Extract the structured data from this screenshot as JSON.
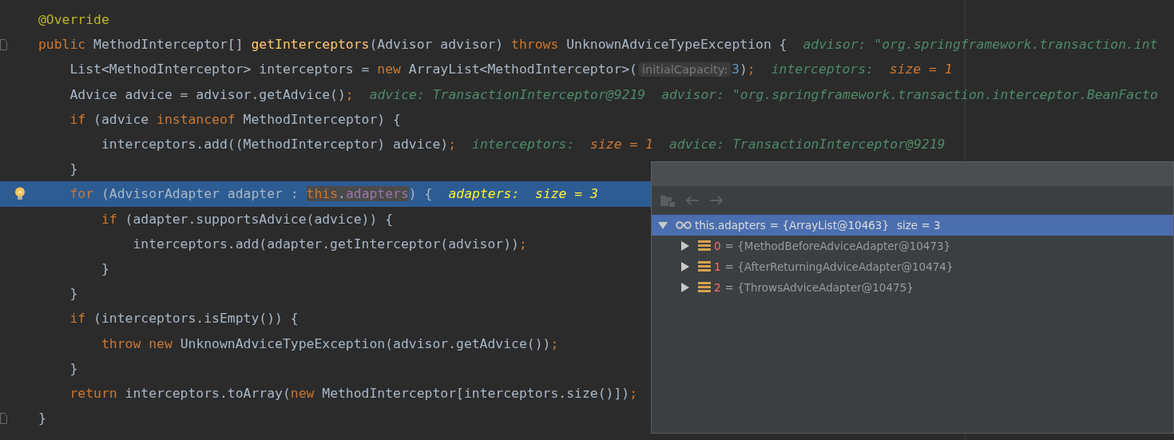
{
  "code": {
    "lines": [
      {
        "selected": false,
        "segments": [
          {
            "kind": "code",
            "tokens": [
              {
                "text": "@Override",
                "kind": "annotation"
              }
            ]
          }
        ]
      },
      {
        "selected": false,
        "gutter": {
          "kind": "fold"
        },
        "segments": [
          {
            "kind": "code",
            "tokens": [
              {
                "text": "public ",
                "kind": "keyword"
              },
              {
                "text": "MethodInterceptor[] ",
                "kind": "plain"
              },
              {
                "text": "getInterceptors",
                "kind": "method"
              },
              {
                "text": "(Advisor advisor) ",
                "kind": "plain"
              },
              {
                "text": "throws ",
                "kind": "keyword"
              },
              {
                "text": "UnknownAdviceTypeException {",
                "kind": "plain"
              }
            ]
          },
          {
            "kind": "value_hint",
            "tokens": [
              {
                "text": "advisor: \"org.springframework.transaction.int",
                "kind": "name"
              }
            ]
          }
        ],
        "children": [
          {
            "selected": false,
            "segments": [
              {
                "kind": "code",
                "tokens": [
                  {
                    "text": "List<MethodInterceptor> interceptors = ",
                    "kind": "plain"
                  },
                  {
                    "text": "new ",
                    "kind": "keyword"
                  },
                  {
                    "text": "ArrayList<MethodInterceptor>(",
                    "kind": "plain"
                  }
                ]
              },
              {
                "kind": "param_hint",
                "text": "initialCapacity:"
              },
              {
                "kind": "code",
                "tokens": [
                  {
                    "text": "3",
                    "kind": "number"
                  },
                  {
                    "text": ")",
                    "kind": "plain"
                  },
                  {
                    "text": ";",
                    "kind": "punct"
                  }
                ]
              },
              {
                "kind": "value_hint",
                "tokens": [
                  {
                    "text": "interceptors:  ",
                    "kind": "name"
                  },
                  {
                    "text": "size = 1",
                    "kind": "size"
                  }
                ]
              }
            ]
          },
          {
            "selected": false,
            "segments": [
              {
                "kind": "code",
                "tokens": [
                  {
                    "text": "Advice advice = advisor.getAdvice()",
                    "kind": "plain"
                  },
                  {
                    "text": ";",
                    "kind": "punct"
                  }
                ]
              },
              {
                "kind": "value_hint",
                "tokens": [
                  {
                    "text": "advice: TransactionInterceptor@9219",
                    "kind": "name"
                  }
                ]
              },
              {
                "kind": "value_hint",
                "tokens": [
                  {
                    "text": "advisor: \"org.springframework.transaction.interceptor.BeanFacto",
                    "kind": "name"
                  }
                ]
              }
            ]
          },
          {
            "selected": false,
            "segments": [
              {
                "kind": "code",
                "tokens": [
                  {
                    "text": "if ",
                    "kind": "keyword"
                  },
                  {
                    "text": "(advice ",
                    "kind": "plain"
                  },
                  {
                    "text": "instanceof ",
                    "kind": "keyword"
                  },
                  {
                    "text": "MethodInterceptor) {",
                    "kind": "plain"
                  }
                ]
              }
            ],
            "children": [
              {
                "selected": false,
                "segments": [
                  {
                    "kind": "code",
                    "tokens": [
                      {
                        "text": "interceptors.add((MethodInterceptor) advice)",
                        "kind": "plain"
                      },
                      {
                        "text": ";",
                        "kind": "punct"
                      }
                    ]
                  },
                  {
                    "kind": "value_hint",
                    "tokens": [
                      {
                        "text": "interceptors:  ",
                        "kind": "name"
                      },
                      {
                        "text": "size = 1",
                        "kind": "size"
                      }
                    ]
                  },
                  {
                    "kind": "value_hint",
                    "tokens": [
                      {
                        "text": "advice: TransactionInterceptor@9219",
                        "kind": "name"
                      }
                    ]
                  }
                ]
              }
            ]
          },
          {
            "selected": false,
            "segments": [
              {
                "kind": "code",
                "tokens": [
                  {
                    "text": "}",
                    "kind": "plain"
                  }
                ]
              }
            ]
          },
          {
            "selected": true,
            "gutter": {
              "kind": "bulb"
            },
            "segments": [
              {
                "kind": "code",
                "tokens": [
                  {
                    "text": "for ",
                    "kind": "keyword"
                  },
                  {
                    "text": "(AdvisorAdapter adapter : ",
                    "kind": "plain"
                  }
                ]
              },
              {
                "kind": "usage",
                "tokens": [
                  {
                    "text": "this",
                    "kind": "keyword"
                  },
                  {
                    "text": ".",
                    "kind": "plain"
                  },
                  {
                    "text": "adapters",
                    "kind": "field"
                  }
                ]
              },
              {
                "kind": "code",
                "tokens": [
                  {
                    "text": ") {",
                    "kind": "plain"
                  }
                ]
              },
              {
                "kind": "value_hint",
                "tokens": [
                  {
                    "text": "adapters:  ",
                    "kind": "name"
                  },
                  {
                    "text": "size = 3",
                    "kind": "size"
                  }
                ]
              }
            ],
            "children": [
              {
                "selected": false,
                "segments": [
                  {
                    "kind": "code",
                    "tokens": [
                      {
                        "text": "if ",
                        "kind": "keyword"
                      },
                      {
                        "text": "(adapter.supportsAdvice(advice)) {",
                        "kind": "plain"
                      }
                    ]
                  }
                ],
                "children": [
                  {
                    "selected": false,
                    "segments": [
                      {
                        "kind": "code",
                        "tokens": [
                          {
                            "text": "interceptors.add(adapter.getInterceptor(advisor))",
                            "kind": "plain"
                          },
                          {
                            "text": ";",
                            "kind": "punct"
                          }
                        ]
                      }
                    ]
                  }
                ]
              },
              {
                "selected": false,
                "segments": [
                  {
                    "kind": "code",
                    "tokens": [
                      {
                        "text": "}",
                        "kind": "plain"
                      }
                    ]
                  }
                ]
              }
            ]
          },
          {
            "selected": false,
            "segments": [
              {
                "kind": "code",
                "tokens": [
                  {
                    "text": "}",
                    "kind": "plain"
                  }
                ]
              }
            ]
          },
          {
            "selected": false,
            "segments": [
              {
                "kind": "code",
                "tokens": [
                  {
                    "text": "if ",
                    "kind": "keyword"
                  },
                  {
                    "text": "(interceptors.isEmpty()) {",
                    "kind": "plain"
                  }
                ]
              }
            ],
            "children": [
              {
                "selected": false,
                "segments": [
                  {
                    "kind": "code",
                    "tokens": [
                      {
                        "text": "throw ",
                        "kind": "keyword"
                      },
                      {
                        "text": "new ",
                        "kind": "keyword"
                      },
                      {
                        "text": "UnknownAdviceTypeException(advisor.getAdvice())",
                        "kind": "plain"
                      },
                      {
                        "text": ";",
                        "kind": "punct"
                      }
                    ]
                  }
                ]
              }
            ]
          },
          {
            "selected": false,
            "segments": [
              {
                "kind": "code",
                "tokens": [
                  {
                    "text": "}",
                    "kind": "plain"
                  }
                ]
              }
            ]
          },
          {
            "selected": false,
            "segments": [
              {
                "kind": "code",
                "tokens": [
                  {
                    "text": "return ",
                    "kind": "keyword"
                  },
                  {
                    "text": "interceptors.toArray(",
                    "kind": "plain"
                  },
                  {
                    "text": "new ",
                    "kind": "keyword"
                  },
                  {
                    "text": "MethodInterceptor[interceptors.size()])",
                    "kind": "plain"
                  },
                  {
                    "text": ";",
                    "kind": "punct"
                  }
                ]
              }
            ]
          }
        ]
      },
      {
        "selected": false,
        "gutter": {
          "kind": "fold"
        },
        "segments": [
          {
            "kind": "code",
            "tokens": [
              {
                "text": "}",
                "kind": "plain"
              }
            ]
          }
        ]
      }
    ]
  },
  "debugger_popup": {
    "toolbar": [
      {
        "kind": "folder",
        "disabled": true
      },
      {
        "kind": "back",
        "disabled": true
      },
      {
        "kind": "forward",
        "disabled": true
      }
    ],
    "tree": [
      {
        "kind": "watch",
        "name": "this.adapters",
        "value": "= {ArrayList@10463}",
        "size": "size = 3",
        "expanded": true,
        "selected": true,
        "children": [
          {
            "kind": "element",
            "name": "0",
            "value": "= {MethodBeforeAdviceAdapter@10473}",
            "expanded": false,
            "selected": false
          },
          {
            "kind": "element",
            "name": "1",
            "value": "= {AfterReturningAdviceAdapter@10474}",
            "expanded": false,
            "selected": false
          },
          {
            "kind": "element",
            "name": "2",
            "value": "= {ThrowsAdviceAdapter@10475}",
            "expanded": false,
            "selected": false
          }
        ]
      }
    ]
  }
}
